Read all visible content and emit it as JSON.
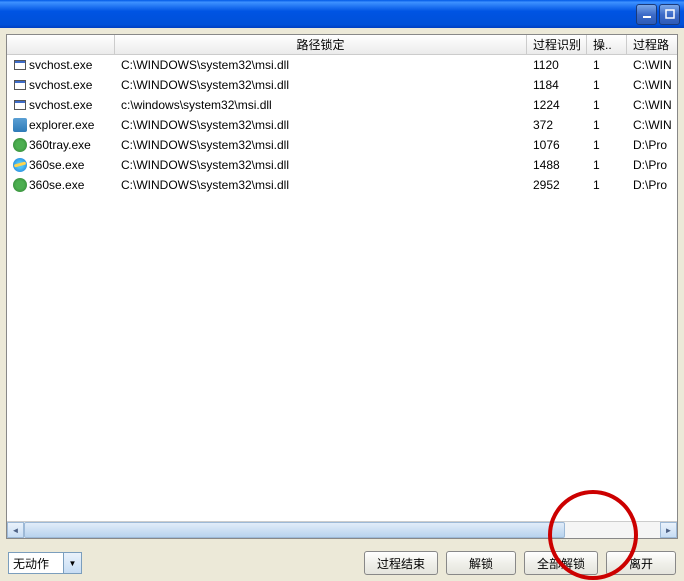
{
  "headers": {
    "path_lock": "路径锁定",
    "pid": "过程识别",
    "op": "操..",
    "proc": "过程路"
  },
  "rows": [
    {
      "icon": "app",
      "name": "svchost.exe",
      "path": "C:\\WINDOWS\\system32\\msi.dll",
      "pid": "1120",
      "op": "1",
      "proc": "C:\\WIN"
    },
    {
      "icon": "app",
      "name": "svchost.exe",
      "path": "C:\\WINDOWS\\system32\\msi.dll",
      "pid": "1184",
      "op": "1",
      "proc": "C:\\WIN"
    },
    {
      "icon": "app",
      "name": "svchost.exe",
      "path": "c:\\windows\\system32\\msi.dll",
      "pid": "1224",
      "op": "1",
      "proc": "C:\\WIN"
    },
    {
      "icon": "explorer",
      "name": "explorer.exe",
      "path": "C:\\WINDOWS\\system32\\msi.dll",
      "pid": "372",
      "op": "1",
      "proc": "C:\\WIN"
    },
    {
      "icon": "360",
      "name": "360tray.exe",
      "path": "C:\\WINDOWS\\system32\\msi.dll",
      "pid": "1076",
      "op": "1",
      "proc": "D:\\Pro"
    },
    {
      "icon": "ie",
      "name": "360se.exe",
      "path": "C:\\WINDOWS\\system32\\msi.dll",
      "pid": "1488",
      "op": "1",
      "proc": "D:\\Pro"
    },
    {
      "icon": "360",
      "name": "360se.exe",
      "path": "C:\\WINDOWS\\system32\\msi.dll",
      "pid": "2952",
      "op": "1",
      "proc": "D:\\Pro"
    }
  ],
  "dropdown": {
    "selected": "无动作"
  },
  "buttons": {
    "end_process": "过程结束",
    "unlock": "解锁",
    "unlock_all": "全部解锁",
    "leave": "离开"
  }
}
